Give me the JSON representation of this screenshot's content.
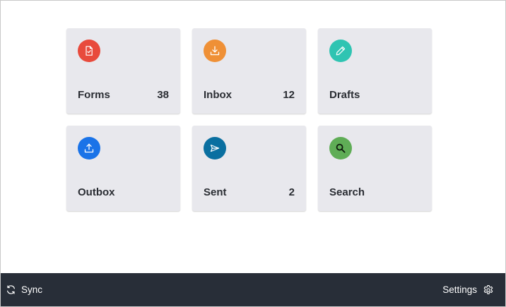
{
  "tiles": [
    {
      "label": "Forms",
      "count": "38",
      "icon": "form-check-icon",
      "color": "#e84a3c"
    },
    {
      "label": "Inbox",
      "count": "12",
      "icon": "download-icon",
      "color": "#ef9036"
    },
    {
      "label": "Drafts",
      "count": "",
      "icon": "pencil-icon",
      "color": "#2fc4b2"
    },
    {
      "label": "Outbox",
      "count": "",
      "icon": "upload-icon",
      "color": "#1a73e8"
    },
    {
      "label": "Sent",
      "count": "2",
      "icon": "send-icon",
      "color": "#0a6fa0"
    },
    {
      "label": "Search",
      "count": "",
      "icon": "search-icon",
      "color": "#5fad56"
    }
  ],
  "footer": {
    "sync_label": "Sync",
    "settings_label": "Settings"
  }
}
